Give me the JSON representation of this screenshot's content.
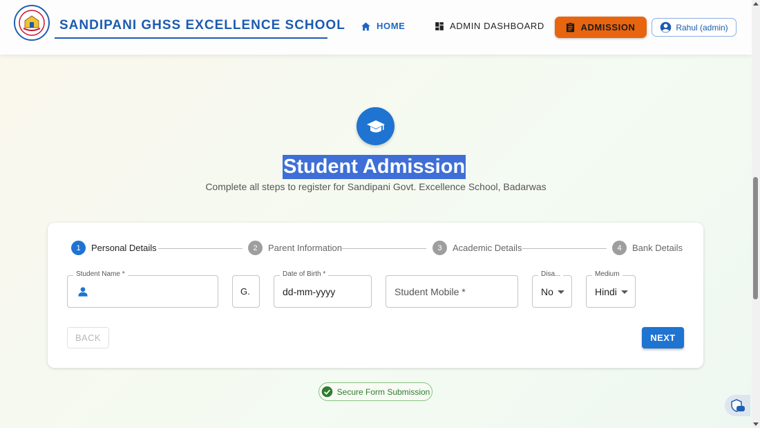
{
  "header": {
    "school_name": "SANDIPANI GHSS EXCELLENCE SCHOOL",
    "nav": {
      "home": "HOME",
      "admin_dashboard": "ADMIN DASHBOARD",
      "admission": "ADMISSION"
    },
    "user": "Rahul (admin)"
  },
  "hero": {
    "title": "Student Admission",
    "subtitle": "Complete all steps to register for Sandipani Govt. Excellence School, Badarwas"
  },
  "stepper": {
    "steps": [
      {
        "number": "1",
        "label": "Personal Details"
      },
      {
        "number": "2",
        "label": "Parent Information"
      },
      {
        "number": "3",
        "label": "Academic Details"
      },
      {
        "number": "4",
        "label": "Bank Details"
      }
    ]
  },
  "form": {
    "student_name_label": "Student Name *",
    "gender_value": "G.",
    "dob_label": "Date of Birth *",
    "dob_value": "dd-mm-yyyy",
    "mobile_placeholder": "Student Mobile *",
    "disability_label": "Disa...",
    "disability_value": "No",
    "medium_label": "Medium",
    "medium_value": "Hindi"
  },
  "buttons": {
    "back": "BACK",
    "next": "NEXT"
  },
  "secure_text": "Secure Form Submission",
  "colors": {
    "primary": "#1f73d1",
    "brand_text": "#1c5bb0",
    "admission_orange": "#e8650f",
    "secure_green": "#2e7d32"
  }
}
